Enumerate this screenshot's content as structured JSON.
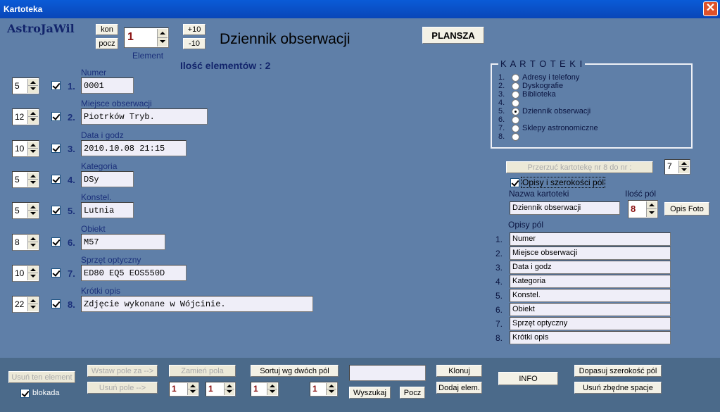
{
  "window": {
    "title": "Kartoteka",
    "close_icon": "close-icon"
  },
  "app": {
    "logo": "AstroJaWil",
    "heading": "Dziennik obserwacji",
    "count_label": "Ilość elementów : 2"
  },
  "nav": {
    "kon": "kon",
    "pocz": "pocz",
    "element_value": "1",
    "element_label": "Element",
    "plus10": "+10",
    "minus10": "-10",
    "plansza": "PLANSZA"
  },
  "fields": [
    {
      "num": "1.",
      "label": "Numer",
      "width": "5",
      "value": "0001"
    },
    {
      "num": "2.",
      "label": "Miejsce obserwacji",
      "width": "12",
      "value": "Piotrków Tryb."
    },
    {
      "num": "3.",
      "label": "Data i godz",
      "width": "10",
      "value": "2010.10.08 21:15"
    },
    {
      "num": "4.",
      "label": "Kategoria",
      "width": "5",
      "value": "DSy"
    },
    {
      "num": "5.",
      "label": "Konstel.",
      "width": "5",
      "value": "Lutnia"
    },
    {
      "num": "6.",
      "label": "Obiekt",
      "width": "8",
      "value": "M57"
    },
    {
      "num": "7.",
      "label": "Sprzęt optyczny",
      "width": "10",
      "value": "ED80 EQ5 EOS550D"
    },
    {
      "num": "8.",
      "label": "Krótki opis",
      "width": "22",
      "value": "Zdjęcie wykonane w Wójcinie."
    }
  ],
  "kartoteki": {
    "title": "K A R T O T E K I",
    "items": [
      {
        "num": "1.",
        "label": "Adresy i telefony"
      },
      {
        "num": "2.",
        "label": "Dyskografie"
      },
      {
        "num": "3.",
        "label": "Biblioteka"
      },
      {
        "num": "4.",
        "label": ""
      },
      {
        "num": "5.",
        "label": "Dziennik obserwacji",
        "selected": true
      },
      {
        "num": "6.",
        "label": ""
      },
      {
        "num": "7.",
        "label": "Sklepy astronomiczne"
      },
      {
        "num": "8.",
        "label": ""
      }
    ]
  },
  "right": {
    "przerzuc": "Przerzuć kartotekę nr 8 do nr :",
    "przerzuc_value": "7",
    "opisy_check": "Opisy i szerokości pól",
    "nazwa_label": "Nazwa kartoteki",
    "nazwa_value": "Dziennik obserwacji",
    "ilosc_label": "Ilość pól",
    "ilosc_value": "8",
    "opis_foto": "Opis Foto",
    "opisy_label": "Opisy pól",
    "opisy": [
      {
        "num": "1.",
        "value": "Numer"
      },
      {
        "num": "2.",
        "value": "Miejsce obserwacji"
      },
      {
        "num": "3.",
        "value": "Data i godz"
      },
      {
        "num": "4.",
        "value": "Kategoria"
      },
      {
        "num": "5.",
        "value": "Konstel."
      },
      {
        "num": "6.",
        "value": "Obiekt"
      },
      {
        "num": "7.",
        "value": "Sprzęt optyczny"
      },
      {
        "num": "8.",
        "value": "Krótki opis"
      }
    ]
  },
  "bottom": {
    "usun_element": "Usuń ten element",
    "blokada": "blokada",
    "wstaw_pole": "Wstaw pole za -->",
    "usun_pole": "Usuń pole -->",
    "zamien_pola": "Zamień pola",
    "sortuj": "Sortuj wg dwóch pól",
    "wyszukaj": "Wyszukaj",
    "pocz": "Pocz",
    "klonuj": "Klonuj",
    "dodaj": "Dodaj elem.",
    "info": "INFO",
    "dopasuj": "Dopasuj szerokość pól",
    "usun_spacje": "Usuń zbędne spacje",
    "spin1": "1",
    "spin2": "1",
    "spin3": "1",
    "spin4": "1",
    "search_value": ""
  },
  "colors": {
    "background": "#5f7fa8",
    "titlebar": "#0a5bd7",
    "label_text": "#1a2f7a"
  }
}
